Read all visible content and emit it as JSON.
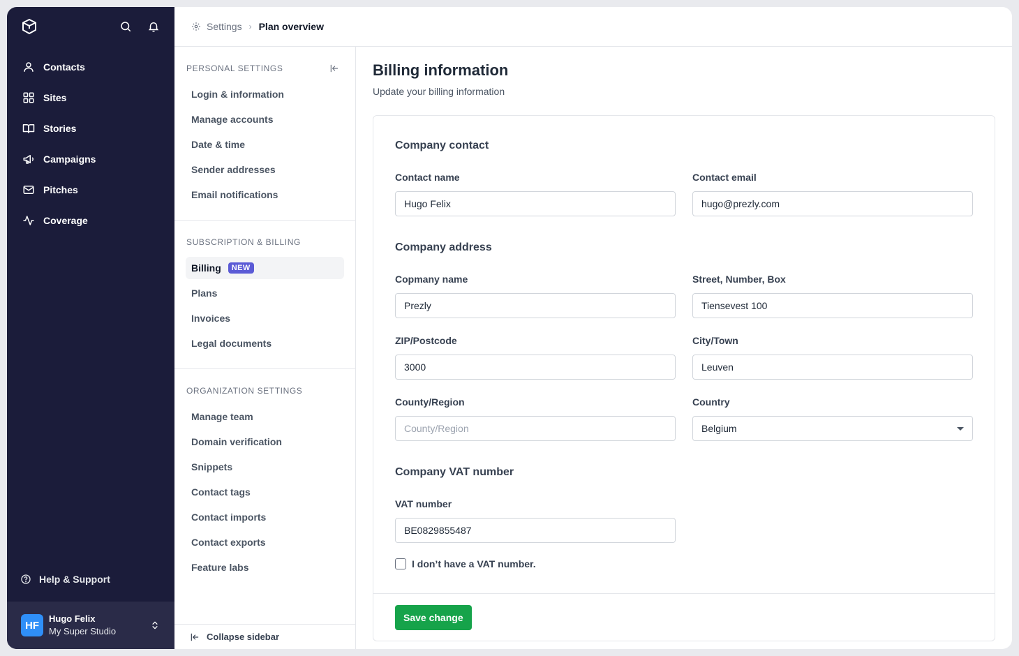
{
  "nav": {
    "items": [
      {
        "label": "Contacts",
        "icon": "user-icon"
      },
      {
        "label": "Sites",
        "icon": "grid-icon"
      },
      {
        "label": "Stories",
        "icon": "book-icon"
      },
      {
        "label": "Campaigns",
        "icon": "megaphone-icon"
      },
      {
        "label": "Pitches",
        "icon": "mail-icon"
      },
      {
        "label": "Coverage",
        "icon": "activity-icon"
      }
    ],
    "help_label": "Help & Support",
    "user": {
      "initials": "HF",
      "name": "Hugo Felix",
      "studio": "My Super Studio"
    }
  },
  "breadcrumb": {
    "parent": "Settings",
    "current": "Plan overview"
  },
  "settings_sidebar": {
    "personal": {
      "title": "PERSONAL SETTINGS",
      "items": [
        "Login & information",
        "Manage accounts",
        "Date & time",
        "Sender addresses",
        "Email notifications"
      ]
    },
    "subscription": {
      "title": "SUBSCRIPTION & BILLING",
      "active": {
        "label": "Billing",
        "badge": "NEW"
      },
      "items": [
        "Plans",
        "Invoices",
        "Legal documents"
      ]
    },
    "organization": {
      "title": "ORGANIZATION SETTINGS",
      "items": [
        "Manage team",
        "Domain verification",
        "Snippets",
        "Contact tags",
        "Contact imports",
        "Contact exports",
        "Feature labs"
      ]
    },
    "collapse_label": "Collapse sidebar"
  },
  "page": {
    "title": "Billing information",
    "subtitle": "Update your billing information"
  },
  "form": {
    "contact": {
      "title": "Company contact",
      "name_label": "Contact name",
      "name_value": "Hugo Felix",
      "email_label": "Contact email",
      "email_value": "hugo@prezly.com"
    },
    "address": {
      "title": "Company address",
      "company_label": "Copmany name",
      "company_value": "Prezly",
      "street_label": "Street, Number, Box",
      "street_value": "Tiensevest 100",
      "zip_label": "ZIP/Postcode",
      "zip_value": "3000",
      "city_label": "City/Town",
      "city_value": "Leuven",
      "county_label": "County/Region",
      "county_placeholder": "County/Region",
      "country_label": "Country",
      "country_value": "Belgium"
    },
    "vat": {
      "title": "Company VAT number",
      "label": "VAT number",
      "value": "BE0829855487",
      "no_vat_label": "I don’t have a VAT number."
    },
    "save_label": "Save change"
  },
  "colors": {
    "nav_bg": "#1b1c3a",
    "accent_badge": "#5b5bd6",
    "save_button": "#16a34a",
    "avatar": "#2f8ff8"
  }
}
